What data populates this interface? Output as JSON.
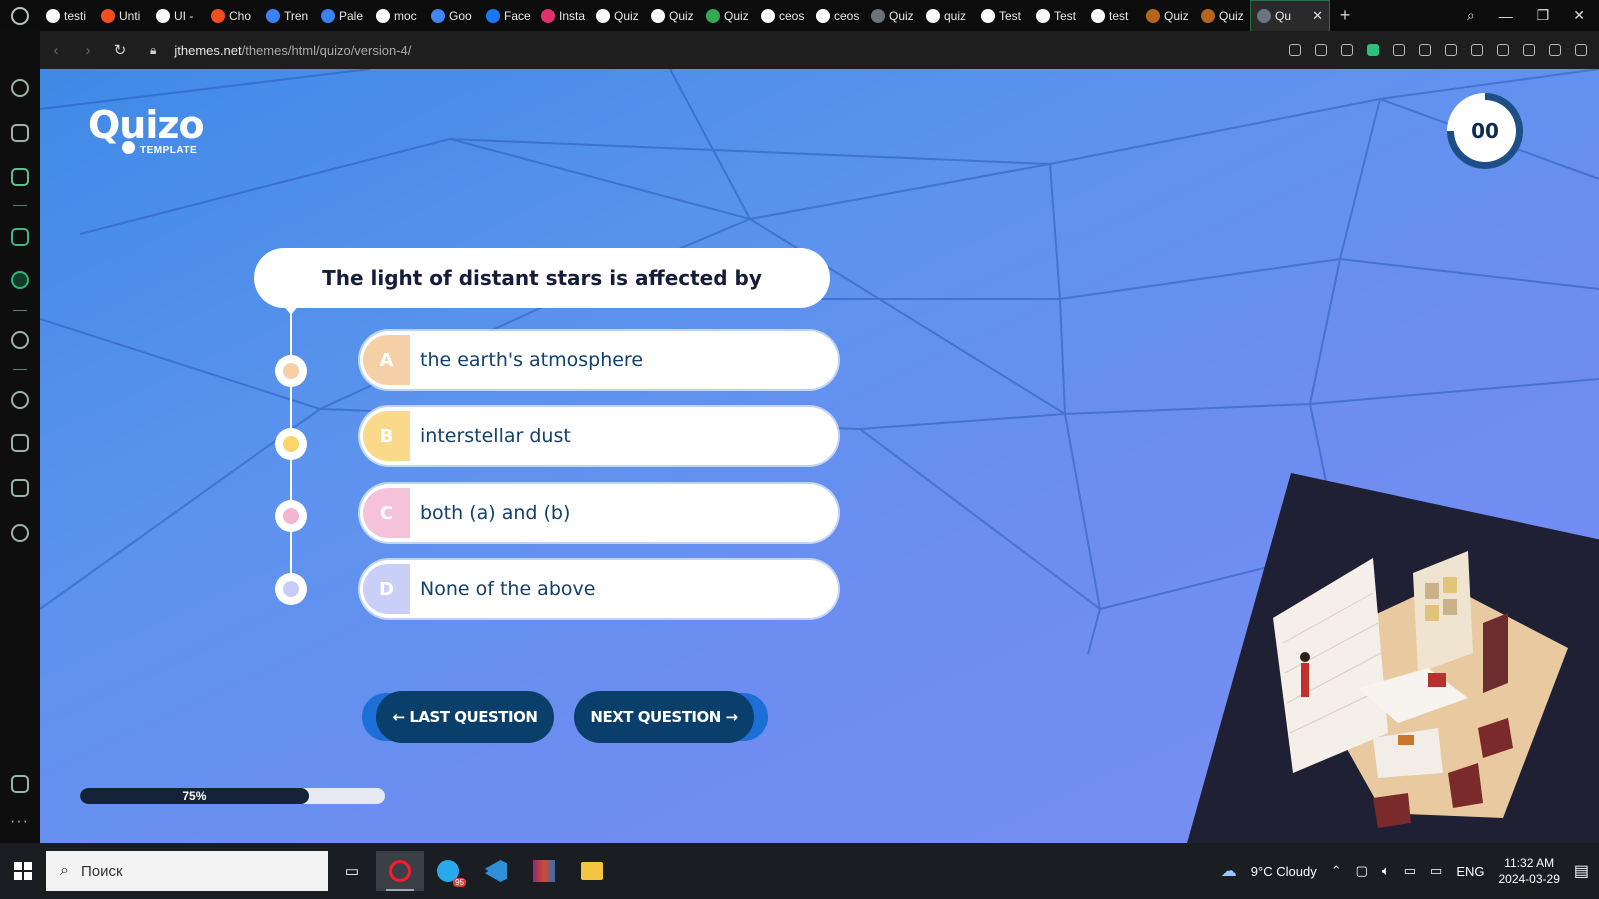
{
  "browser": {
    "tabs": [
      {
        "label": "testi",
        "color": "#ffffff"
      },
      {
        "label": "Unti",
        "color": "#f24e1e"
      },
      {
        "label": "UI -",
        "color": "#ffffff"
      },
      {
        "label": "Cho",
        "color": "#f24e1e"
      },
      {
        "label": "Tren",
        "color": "#3b82f6"
      },
      {
        "label": "Pale",
        "color": "#3b82f6"
      },
      {
        "label": "moc",
        "color": "#ffffff"
      },
      {
        "label": "Goo",
        "color": "#4285f4"
      },
      {
        "label": "Face",
        "color": "#1877f2"
      },
      {
        "label": "Insta",
        "color": "#e1306c"
      },
      {
        "label": "Quiz",
        "color": "#ffffff"
      },
      {
        "label": "Quiz",
        "color": "#ffffff"
      },
      {
        "label": "Quiz",
        "color": "#34a853"
      },
      {
        "label": "ceos",
        "color": "#ffffff"
      },
      {
        "label": "ceos",
        "color": "#ffffff"
      },
      {
        "label": "Quiz",
        "color": "#6b7280"
      },
      {
        "label": "quiz",
        "color": "#ffffff"
      },
      {
        "label": "Test",
        "color": "#ffffff"
      },
      {
        "label": "Test",
        "color": "#ffffff"
      },
      {
        "label": "test",
        "color": "#ffffff"
      },
      {
        "label": "Quiz",
        "color": "#b5651d"
      },
      {
        "label": "Quiz",
        "color": "#b5651d"
      }
    ],
    "active_tab": {
      "label": "Qu"
    },
    "url_host": "jthemes.net",
    "url_path": "/themes/html/quizo/version-4/"
  },
  "page": {
    "logo": {
      "name": "Quizo",
      "sub": "TEMPLATE"
    },
    "timer": {
      "value": "00"
    },
    "question": "The light of distant stars is affected by",
    "options": [
      {
        "letter": "A",
        "text": "the earth's atmosphere",
        "color": "#f5cfa6",
        "dot": "#f5cfa6"
      },
      {
        "letter": "B",
        "text": "interstellar dust",
        "color": "#fbd98a",
        "dot": "#fbd46a"
      },
      {
        "letter": "C",
        "text": "both (a) and (b)",
        "color": "#f4c2d9",
        "dot": "#f3b5cf"
      },
      {
        "letter": "D",
        "text": "None of the above",
        "color": "#c9cff7",
        "dot": "#c6ccf6"
      }
    ],
    "buttons": {
      "prev": "← LAST QUESTION",
      "next": "NEXT QUESTION →"
    },
    "progress": {
      "value": 75,
      "label": "75%"
    }
  },
  "taskbar": {
    "search_placeholder": "Поиск",
    "weather": "9°C  Cloudy",
    "language": "ENG",
    "time": "11:32 AM",
    "date": "2024-03-29",
    "telegram_badge": "95"
  }
}
